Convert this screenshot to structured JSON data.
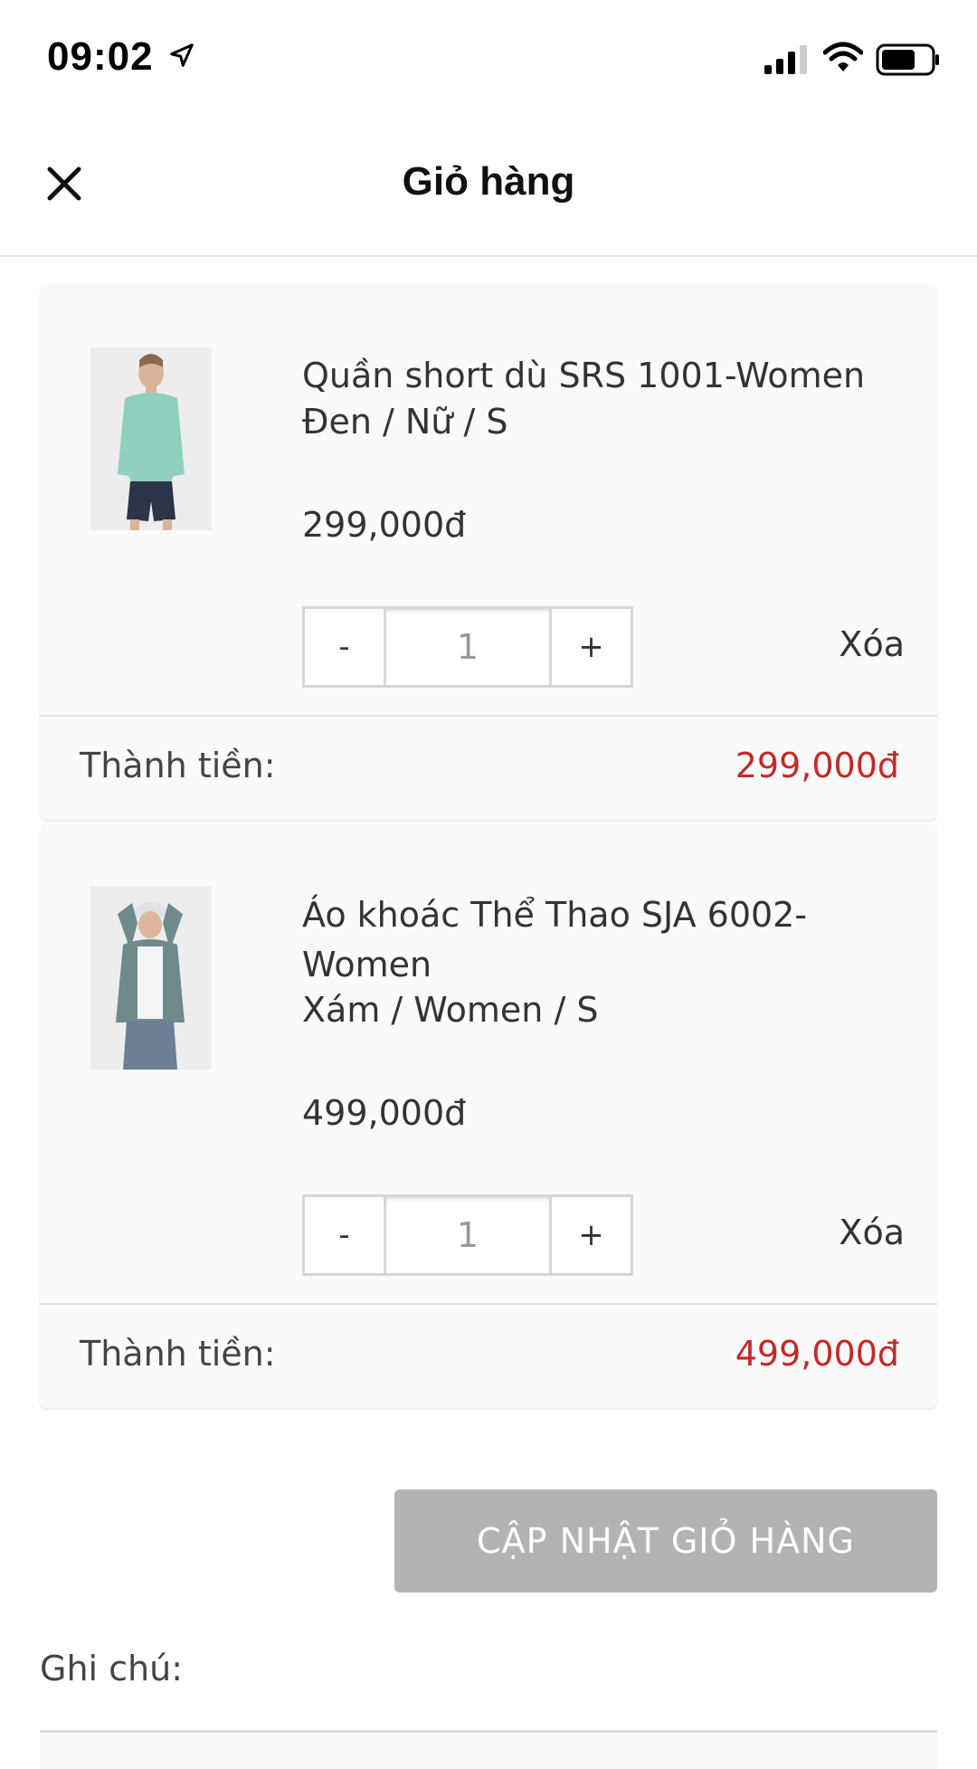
{
  "status_bar": {
    "time": "09:02"
  },
  "header": {
    "title": "Giỏ hàng"
  },
  "cart": {
    "items": [
      {
        "name": "Quần short dù SRS 1001-Women",
        "variant": "Đen / Nữ / S",
        "price": "299,000đ",
        "quantity": "1",
        "decrement_label": "-",
        "increment_label": "+",
        "remove_label": "Xóa",
        "subtotal_label": "Thành tiền:",
        "subtotal": "299,000đ"
      },
      {
        "name": "Áo khoác Thể Thao SJA 6002-Women",
        "variant": "Xám / Women / S",
        "price": "499,000đ",
        "quantity": "1",
        "decrement_label": "-",
        "increment_label": "+",
        "remove_label": "Xóa",
        "subtotal_label": "Thành tiền:",
        "subtotal": "499,000đ"
      }
    ],
    "update_button_label": "CẬP NHẬT GIỎ HÀNG",
    "note_label": "Ghi chú:"
  },
  "colors": {
    "price_red": "#c62828",
    "button_gray": "#b3b3b3",
    "card_bg": "#fafafa"
  },
  "icons": [
    "location-arrow-icon",
    "signal-icon",
    "wifi-icon",
    "battery-icon",
    "close-icon"
  ]
}
